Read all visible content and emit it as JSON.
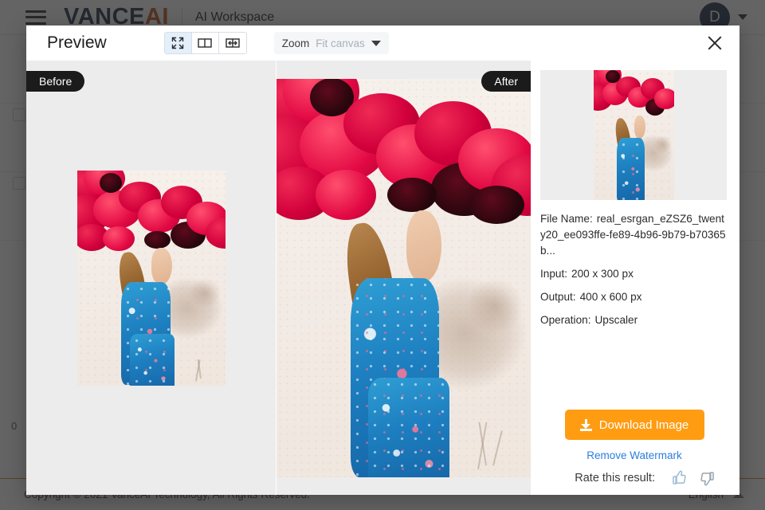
{
  "background": {
    "header": {
      "menu_icon": "hamburger-icon",
      "brand_primary": "VANCE",
      "brand_accent": "AI",
      "workspace_title": "AI Workspace",
      "avatar_initial": "D",
      "avatar_chevron_icon": "chevron-down-icon"
    },
    "table": {
      "row_counter": "0"
    },
    "footer": {
      "copyright": "Copyright © 2021 VanceAI Technology, All Rights Reserved.",
      "language": "English",
      "language_chevron_icon": "chevron-up-icon"
    }
  },
  "modal": {
    "title": "Preview",
    "close_icon": "close-icon",
    "view_modes": [
      {
        "name": "fit-screen",
        "icon": "expand-arrows-icon",
        "active": true
      },
      {
        "name": "side-by-side",
        "icon": "split-view-icon",
        "active": false
      },
      {
        "name": "slider-compare",
        "icon": "compare-slider-icon",
        "active": false
      }
    ],
    "zoom": {
      "label": "Zoom",
      "value": "Fit canvas",
      "caret_icon": "caret-down-icon"
    },
    "panels": {
      "before_badge": "Before",
      "after_badge": "After"
    },
    "info": {
      "file_name_label": "File Name:",
      "file_name_value": "real_esrgan_eZSZ6_twenty20_ee093ffe-fe89-4b96-9b79-b70365b...",
      "input_label": "Input:",
      "input_value": "200 x 300 px",
      "output_label": "Output:",
      "output_value": "400 x 600 px",
      "operation_label": "Operation:",
      "operation_value": "Upscaler"
    },
    "actions": {
      "download_label": "Download Image",
      "download_icon": "download-icon",
      "remove_watermark_label": "Remove Watermark"
    },
    "rating": {
      "label": "Rate this result:",
      "thumb_up_icon": "thumbs-up-icon",
      "thumb_down_icon": "thumbs-down-icon"
    }
  },
  "colors": {
    "accent_orange": "#ff9c12",
    "link_blue": "#2a7fdd",
    "brand_navy": "#1b2a47",
    "brand_orange": "#c0501c"
  }
}
